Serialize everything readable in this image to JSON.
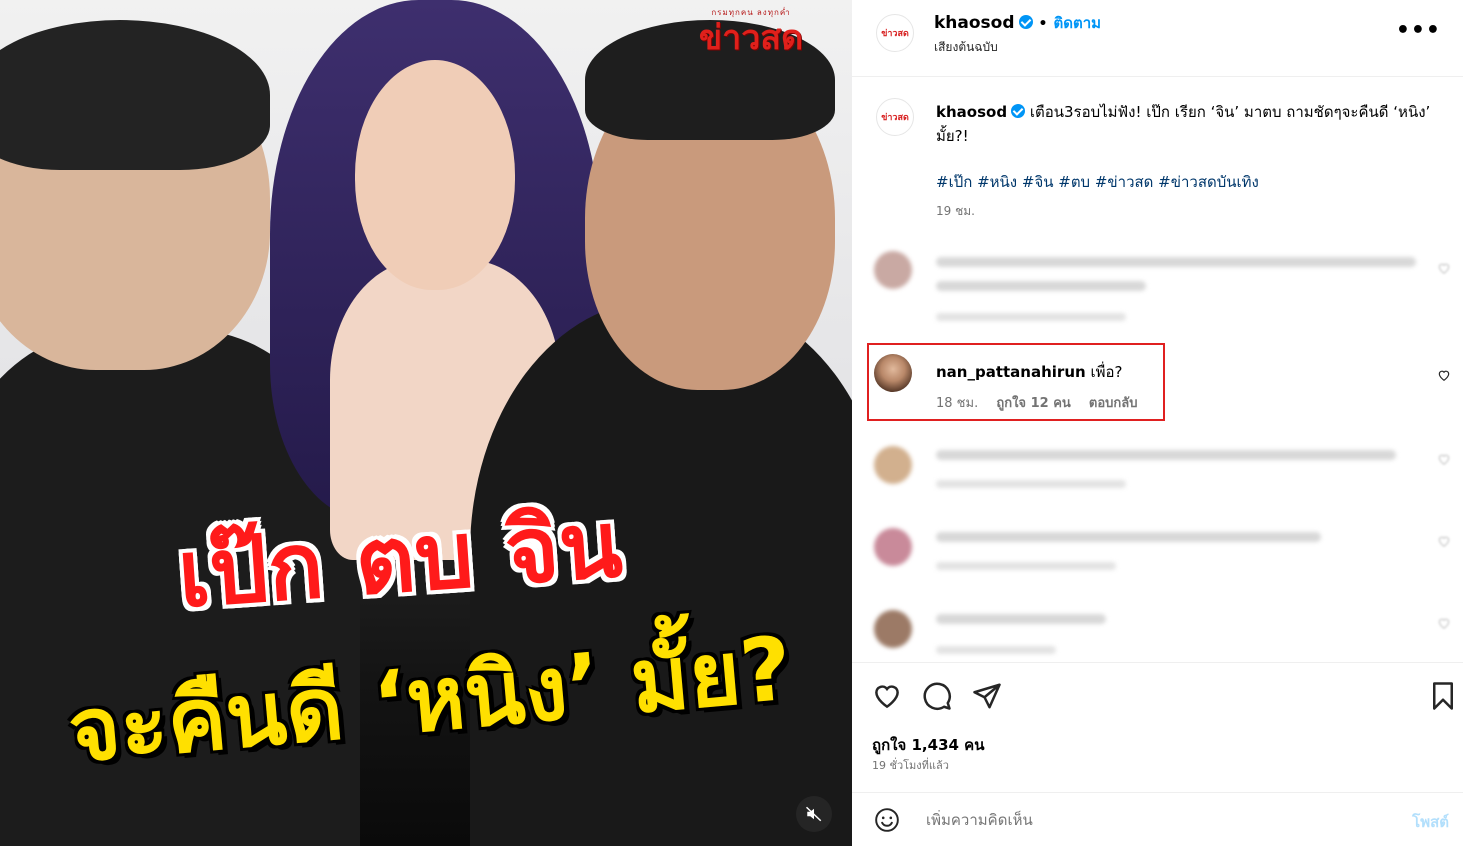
{
  "media": {
    "logo_top": "กรมทุกคน ลงทุกค่ำ",
    "logo_main": "ข่าวสด",
    "headline_line1": "เป๊ก ตบ จิน",
    "headline_line2": "จะคืนดี ‘หนิง’ มั้ย?",
    "mute_icon": "speaker-muted-icon"
  },
  "header": {
    "avatar_text": "ข่าวสด",
    "username": "khaosod",
    "follow_label": "ติดตาม",
    "audio_label": "เสียงต้นฉบับ",
    "more_label": "•••"
  },
  "caption": {
    "avatar_text": "ข่าวสด",
    "username": "khaosod",
    "text": "เตือน3รอบไม่ฟัง! เป๊ก เรียก ‘จิน’ มาตบ ถามชัดๆจะคืนดี ‘หนิง’ มั้ย?!",
    "hashtags": "#เป๊ก #หนิง #จิน #ตบ #ข่าวสด #ข่าวสดบันเทิง",
    "time": "19 ชม."
  },
  "highlighted_comment": {
    "username": "nan_pattanahirun",
    "text": "เพื่อ?",
    "time": "18 ชม.",
    "likes": "ถูกใจ 12 คน",
    "reply": "ตอบกลับ"
  },
  "actions": {
    "likes_text": "ถูกใจ 1,434 คน",
    "time_ago": "19 ชั่วโมงที่แล้ว"
  },
  "add_comment": {
    "placeholder": "เพิ่มความคิดเห็น",
    "post_label": "โพสต์"
  },
  "colors": {
    "accent": "#0095f6",
    "highlight_border": "#e02020",
    "brand_red": "#e0201b"
  }
}
